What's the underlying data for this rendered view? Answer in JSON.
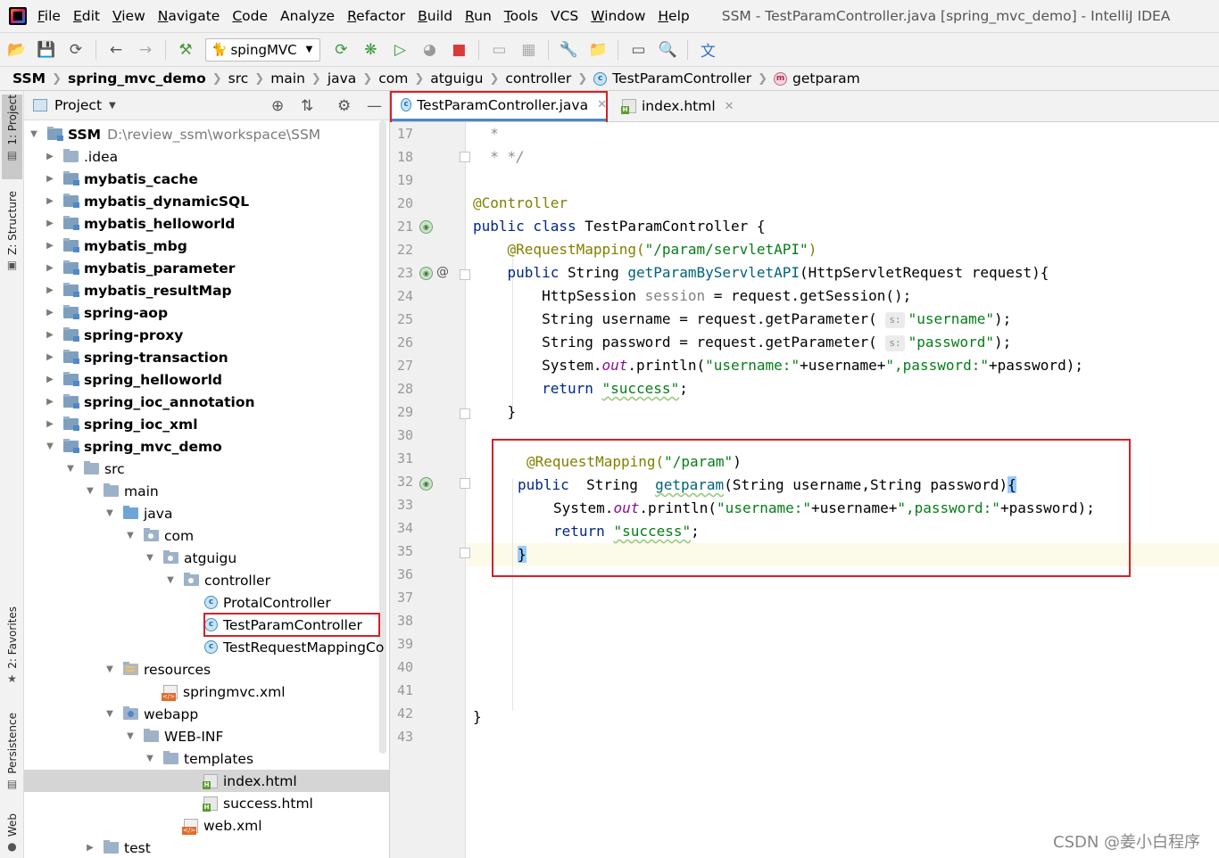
{
  "window": {
    "title": "SSM - TestParamController.java [spring_mvc_demo] - IntelliJ IDEA"
  },
  "menu": [
    {
      "label": "File",
      "key": "F",
      "rest": "ile"
    },
    {
      "label": "Edit",
      "key": "E",
      "rest": "dit"
    },
    {
      "label": "View",
      "key": "V",
      "rest": "iew"
    },
    {
      "label": "Navigate",
      "key": "N",
      "rest": "avigate"
    },
    {
      "label": "Code",
      "key": "C",
      "rest": "ode"
    },
    {
      "label": "Analyze",
      "key": "",
      "rest": "Analyze"
    },
    {
      "label": "Refactor",
      "key": "R",
      "rest": "efactor"
    },
    {
      "label": "Build",
      "key": "B",
      "rest": "uild"
    },
    {
      "label": "Run",
      "key": "R",
      "rest": "un"
    },
    {
      "label": "Tools",
      "key": "T",
      "rest": "ools"
    },
    {
      "label": "VCS",
      "key": "",
      "rest": "VCS"
    },
    {
      "label": "Window",
      "key": "W",
      "rest": "indow"
    },
    {
      "label": "Help",
      "key": "H",
      "rest": "elp"
    }
  ],
  "toolbar": {
    "run_config": "spingMVC"
  },
  "breadcrumb": [
    "SSM",
    "spring_mvc_demo",
    "src",
    "main",
    "java",
    "com",
    "atguigu",
    "controller",
    "TestParamController",
    "getparam"
  ],
  "tool_strip": {
    "project": "1: Project",
    "structure": "Z: Structure",
    "favorites": "2: Favorites",
    "persistence": "Persistence",
    "web": "Web"
  },
  "project_panel": {
    "title": "Project"
  },
  "tree": [
    {
      "label": "SSM",
      "extra": "D:\\review_ssm\\workspace\\SSM"
    },
    {
      "label": ".idea"
    },
    {
      "label": "mybatis_cache"
    },
    {
      "label": "mybatis_dynamicSQL"
    },
    {
      "label": "mybatis_helloworld"
    },
    {
      "label": "mybatis_mbg"
    },
    {
      "label": "mybatis_parameter"
    },
    {
      "label": "mybatis_resultMap"
    },
    {
      "label": "spring-aop"
    },
    {
      "label": "spring-proxy"
    },
    {
      "label": "spring-transaction"
    },
    {
      "label": "spring_helloworld"
    },
    {
      "label": "spring_ioc_annotation"
    },
    {
      "label": "spring_ioc_xml"
    },
    {
      "label": "spring_mvc_demo"
    },
    {
      "label": "src"
    },
    {
      "label": "main"
    },
    {
      "label": "java"
    },
    {
      "label": "com"
    },
    {
      "label": "atguigu"
    },
    {
      "label": "controller"
    },
    {
      "label": "ProtalController"
    },
    {
      "label": "TestParamController"
    },
    {
      "label": "TestRequestMappingCo"
    },
    {
      "label": "resources"
    },
    {
      "label": "springmvc.xml"
    },
    {
      "label": "webapp"
    },
    {
      "label": "WEB-INF"
    },
    {
      "label": "templates"
    },
    {
      "label": "index.html"
    },
    {
      "label": "success.html"
    },
    {
      "label": "web.xml"
    },
    {
      "label": "test"
    }
  ],
  "tabs": [
    {
      "label": "TestParamController.java"
    },
    {
      "label": "index.html"
    }
  ],
  "line_numbers": [
    "17",
    "18",
    "19",
    "20",
    "21",
    "22",
    "23",
    "24",
    "25",
    "26",
    "27",
    "28",
    "29",
    "30",
    "31",
    "32",
    "33",
    "34",
    "35",
    "36",
    "37",
    "38",
    "39",
    "40",
    "41",
    "42",
    "43"
  ],
  "code": {
    "l17": "*",
    "l18": "* */",
    "l20": "@Controller",
    "l21_kw": "public class",
    "l21_rest": " TestParamController {",
    "l22_ann": "@RequestMapping(",
    "l22_str": "\"/param/servletAPI\"",
    "l22_end": ")",
    "l23_kw": "public",
    "l23_a": " String ",
    "l23_fn": "getParamByServletAPI",
    "l23_b": "(HttpServletRequest request){",
    "l24_a": "HttpSession ",
    "l24_var": "session",
    "l24_b": " = request.getSession();",
    "l25_a": "String username = request.getParameter(",
    "l25_hint": "s:",
    "l25_str": "\"username\"",
    "l25_end": ");",
    "l26_a": "String password = request.getParameter(",
    "l26_hint": "s:",
    "l26_str": "\"password\"",
    "l26_end": ");",
    "l27_a": "System.",
    "l27_out": "out",
    "l27_b": ".println(",
    "l27_s1": "\"username:\"",
    "l27_c": "+username+",
    "l27_s2": "\",password:\"",
    "l27_d": "+password);",
    "l28_kw": "return",
    "l28_str": "\"success\"",
    "l28_end": ";",
    "l29": "}",
    "l31_ann": "@RequestMapping(",
    "l31_str": "\"/param\"",
    "l31_end": ")",
    "l32_kw": "public",
    "l32_a": "  String  ",
    "l32_fn": "getparam",
    "l32_b": "(String username,String password)",
    "l32_brace": "{",
    "l33_a": "System.",
    "l33_out": "out",
    "l33_b": ".println(",
    "l33_s1": "\"username:\"",
    "l33_c": "+username+",
    "l33_s2": "\",password:\"",
    "l33_d": "+password);",
    "l34_kw": "return",
    "l34_str": "\"success\"",
    "l34_end": ";",
    "l35": "}",
    "l42": "}"
  },
  "watermark": "CSDN @姜小白程序",
  "colors": {
    "highlight_box": "#d62027",
    "keyword": "#00268b",
    "annotation": "#808000",
    "string": "#067d17"
  }
}
